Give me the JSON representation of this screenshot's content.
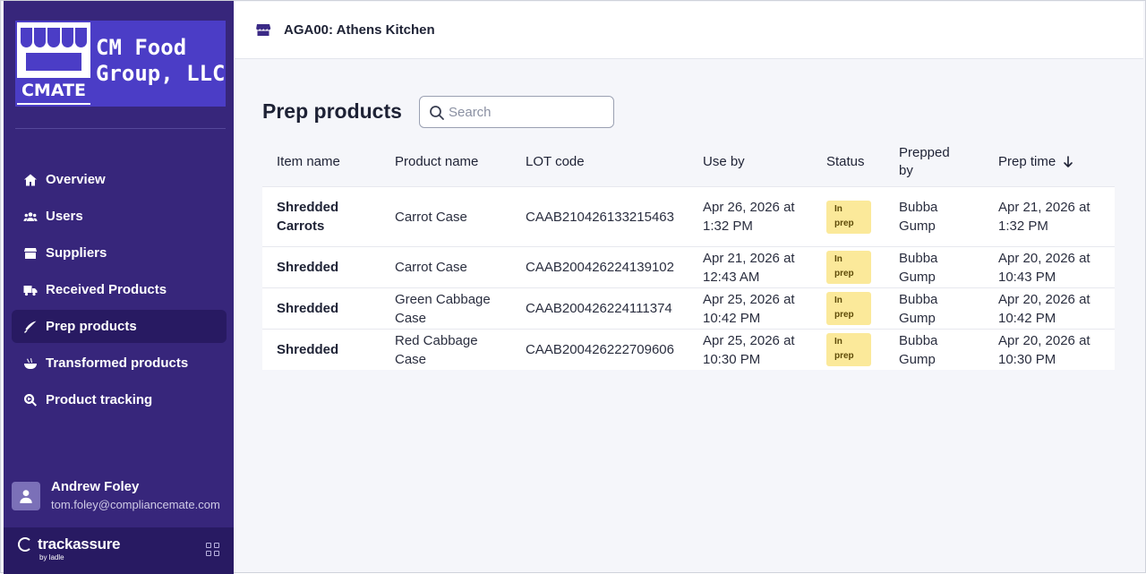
{
  "sidebar": {
    "logo": {
      "mark_text": "CMATE",
      "company": "CM Food\nGroup, LLC"
    },
    "nav": [
      {
        "label": "Overview",
        "icon": "home-icon",
        "active": false
      },
      {
        "label": "Users",
        "icon": "users-icon",
        "active": false
      },
      {
        "label": "Suppliers",
        "icon": "store-icon",
        "active": false
      },
      {
        "label": "Received Products",
        "icon": "truck-icon",
        "active": false
      },
      {
        "label": "Prep products",
        "icon": "knife-icon",
        "active": true
      },
      {
        "label": "Transformed products",
        "icon": "bowl-icon",
        "active": false
      },
      {
        "label": "Product tracking",
        "icon": "search-tracking-icon",
        "active": false
      }
    ],
    "user": {
      "name": "Andrew Foley",
      "email": "tom.foley@compliancemate.com"
    },
    "brand": {
      "name": "trackassure",
      "sub": "by ladle"
    }
  },
  "topbar": {
    "location": "AGA00: Athens Kitchen"
  },
  "main": {
    "title": "Prep products",
    "search": {
      "placeholder": "Search",
      "value": ""
    },
    "columns": {
      "item": "Item name",
      "product": "Product name",
      "lot": "LOT code",
      "use_by": "Use by",
      "status": "Status",
      "prepped_by": "Prepped by",
      "prep_time": "Prep time"
    },
    "rows": [
      {
        "item": "Shredded Carrots",
        "product": "Carrot Case",
        "lot": "CAAB210426133215463",
        "use_by": "Apr 26, 2026 at 1:32 PM",
        "status": "In prep",
        "prepped_by": "Bubba Gump",
        "prep_time": "Apr 21, 2026 at 1:32 PM"
      },
      {
        "item": "Shredded",
        "product": "Carrot Case",
        "lot": "CAAB200426224139102",
        "use_by": "Apr 21, 2026 at 12:43 AM",
        "status": "In prep",
        "prepped_by": "Bubba Gump",
        "prep_time": "Apr 20, 2026 at 10:43 PM"
      },
      {
        "item": "Shredded",
        "product": "Green Cabbage Case",
        "lot": "CAAB200426224111374",
        "use_by": "Apr 25, 2026 at 10:42 PM",
        "status": "In prep",
        "prepped_by": "Bubba Gump",
        "prep_time": "Apr 20, 2026 at 10:42 PM"
      },
      {
        "item": "Shredded",
        "product": "Red Cabbage Case",
        "lot": "CAAB200426222709606",
        "use_by": "Apr 25, 2026 at 10:30 PM",
        "status": "In prep",
        "prepped_by": "Bubba Gump",
        "prep_time": "Apr 20, 2026 at 10:30 PM"
      }
    ]
  },
  "colors": {
    "sidebar_bg": "#37267b",
    "sidebar_active": "#281a62",
    "logo_bg": "#4b3dc6",
    "badge_bg": "#fbe99a",
    "page_bg": "#f5f6fa"
  }
}
